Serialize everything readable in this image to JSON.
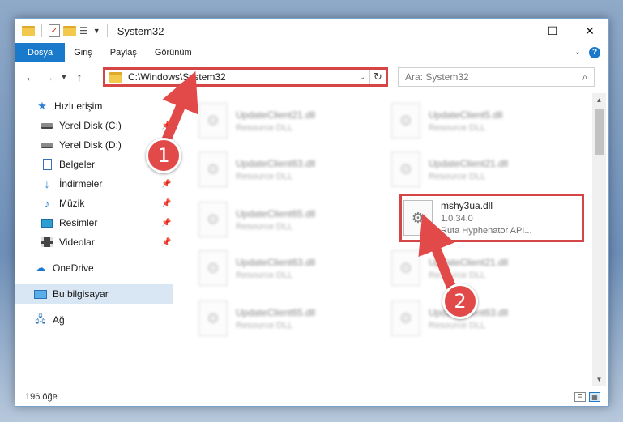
{
  "window": {
    "title": "System32",
    "controls": {
      "minimize": "—",
      "maximize": "☐",
      "close": "✕"
    }
  },
  "ribbon": {
    "tabs": [
      "Dosya",
      "Giriş",
      "Paylaş",
      "Görünüm"
    ]
  },
  "navigation": {
    "path": "C:\\Windows\\System32",
    "search_placeholder": "Ara: System32"
  },
  "sidebar": {
    "items": [
      {
        "label": "Hızlı erişim",
        "icon": "star-icon",
        "pinned": false
      },
      {
        "label": "Yerel Disk (C:)",
        "icon": "disk-icon",
        "pinned": true
      },
      {
        "label": "Yerel Disk (D:)",
        "icon": "disk-icon",
        "pinned": false
      },
      {
        "label": "Belgeler",
        "icon": "document-icon",
        "pinned": true
      },
      {
        "label": "İndirmeler",
        "icon": "download-icon",
        "pinned": true
      },
      {
        "label": "Müzik",
        "icon": "music-icon",
        "pinned": true
      },
      {
        "label": "Resimler",
        "icon": "pictures-icon",
        "pinned": true
      },
      {
        "label": "Videolar",
        "icon": "videos-icon",
        "pinned": true
      },
      {
        "label": "OneDrive",
        "icon": "cloud-icon",
        "pinned": false
      },
      {
        "label": "Bu bilgisayar",
        "icon": "computer-icon",
        "pinned": false,
        "selected": true
      },
      {
        "label": "Ağ",
        "icon": "network-icon",
        "pinned": false
      }
    ]
  },
  "files": {
    "left": [
      {
        "name": "UpdateClient21.dll",
        "type": "Resource DLL"
      },
      {
        "name": "UpdateClient63.dll",
        "type": "Resource DLL"
      },
      {
        "name": "UpdateClient65.dll",
        "type": "Resource DLL"
      },
      {
        "name": "UpdateClient63.dll",
        "type": "Resource DLL"
      },
      {
        "name": "UpdateClient65.dll",
        "type": "Resource DLL"
      }
    ],
    "right": [
      {
        "name": "UpdateClient5.dll",
        "type": "Resource DLL"
      },
      {
        "name": "UpdateClient21.dll",
        "type": "Resource DLL"
      },
      {
        "name": "mshy3ua.dll",
        "version": "1.0.34.0",
        "type": "Ruta Hyphenator API...",
        "highlighted": true
      },
      {
        "name": "UpdateClient21.dll",
        "type": "Resource DLL"
      },
      {
        "name": "UpdateClient63.dll",
        "type": "Resource DLL"
      }
    ]
  },
  "status": {
    "item_count": "196 öğe"
  },
  "annotations": {
    "badge_1": "1",
    "badge_2": "2",
    "color": "#e24a4a"
  }
}
